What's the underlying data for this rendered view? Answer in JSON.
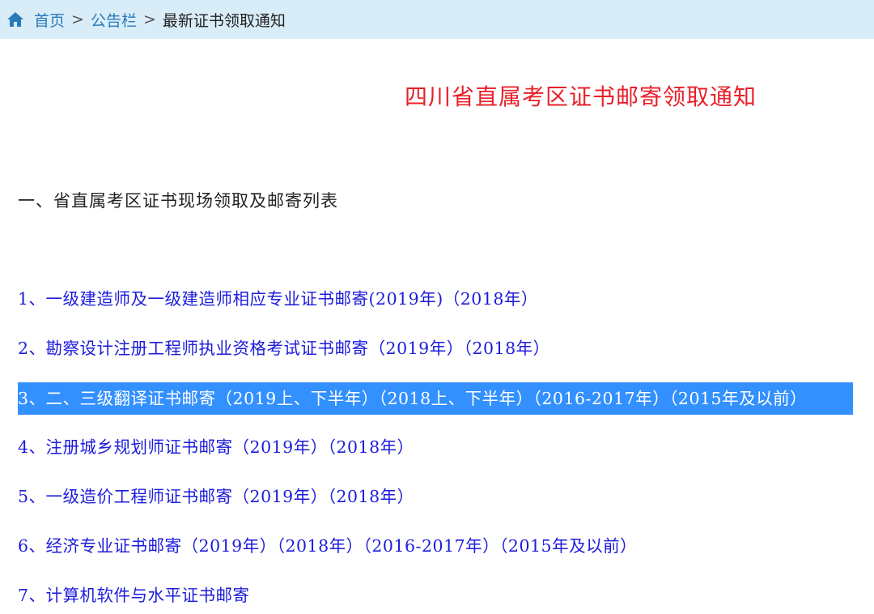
{
  "breadcrumb": {
    "home": "首页",
    "separator": ">",
    "notice_board": "公告栏",
    "current": "最新证书领取通知"
  },
  "title": "四川省直属考区证书邮寄领取通知",
  "section_heading": "一、省直属考区证书现场领取及邮寄列表",
  "items": [
    {
      "label": "1、一级建造师及一级建造师相应专业证书邮寄(2019年)（2018年）"
    },
    {
      "label": "2、勘察设计注册工程师执业资格考试证书邮寄（2019年）（2018年）"
    },
    {
      "label": "3、二、三级翻译证书邮寄（2019上、下半年）（2018上、下半年）（2016-2017年）（2015年及以前）"
    },
    {
      "label": "4、注册城乡规划师证书邮寄（2019年）（2018年）"
    },
    {
      "label": "5、一级造价工程师证书邮寄（2019年）（2018年）"
    },
    {
      "label": "6、经济专业证书邮寄（2019年）（2018年）（2016-2017年）（2015年及以前）"
    },
    {
      "label": "7、计算机软件与水平证书邮寄"
    }
  ],
  "colors": {
    "breadcrumb_bg": "#d9edf9",
    "link": "#2a7ab8",
    "title": "#e8202a",
    "item_link": "#1c1cdc",
    "selection": "#3390ff"
  },
  "icons": {
    "home": "home-icon"
  }
}
